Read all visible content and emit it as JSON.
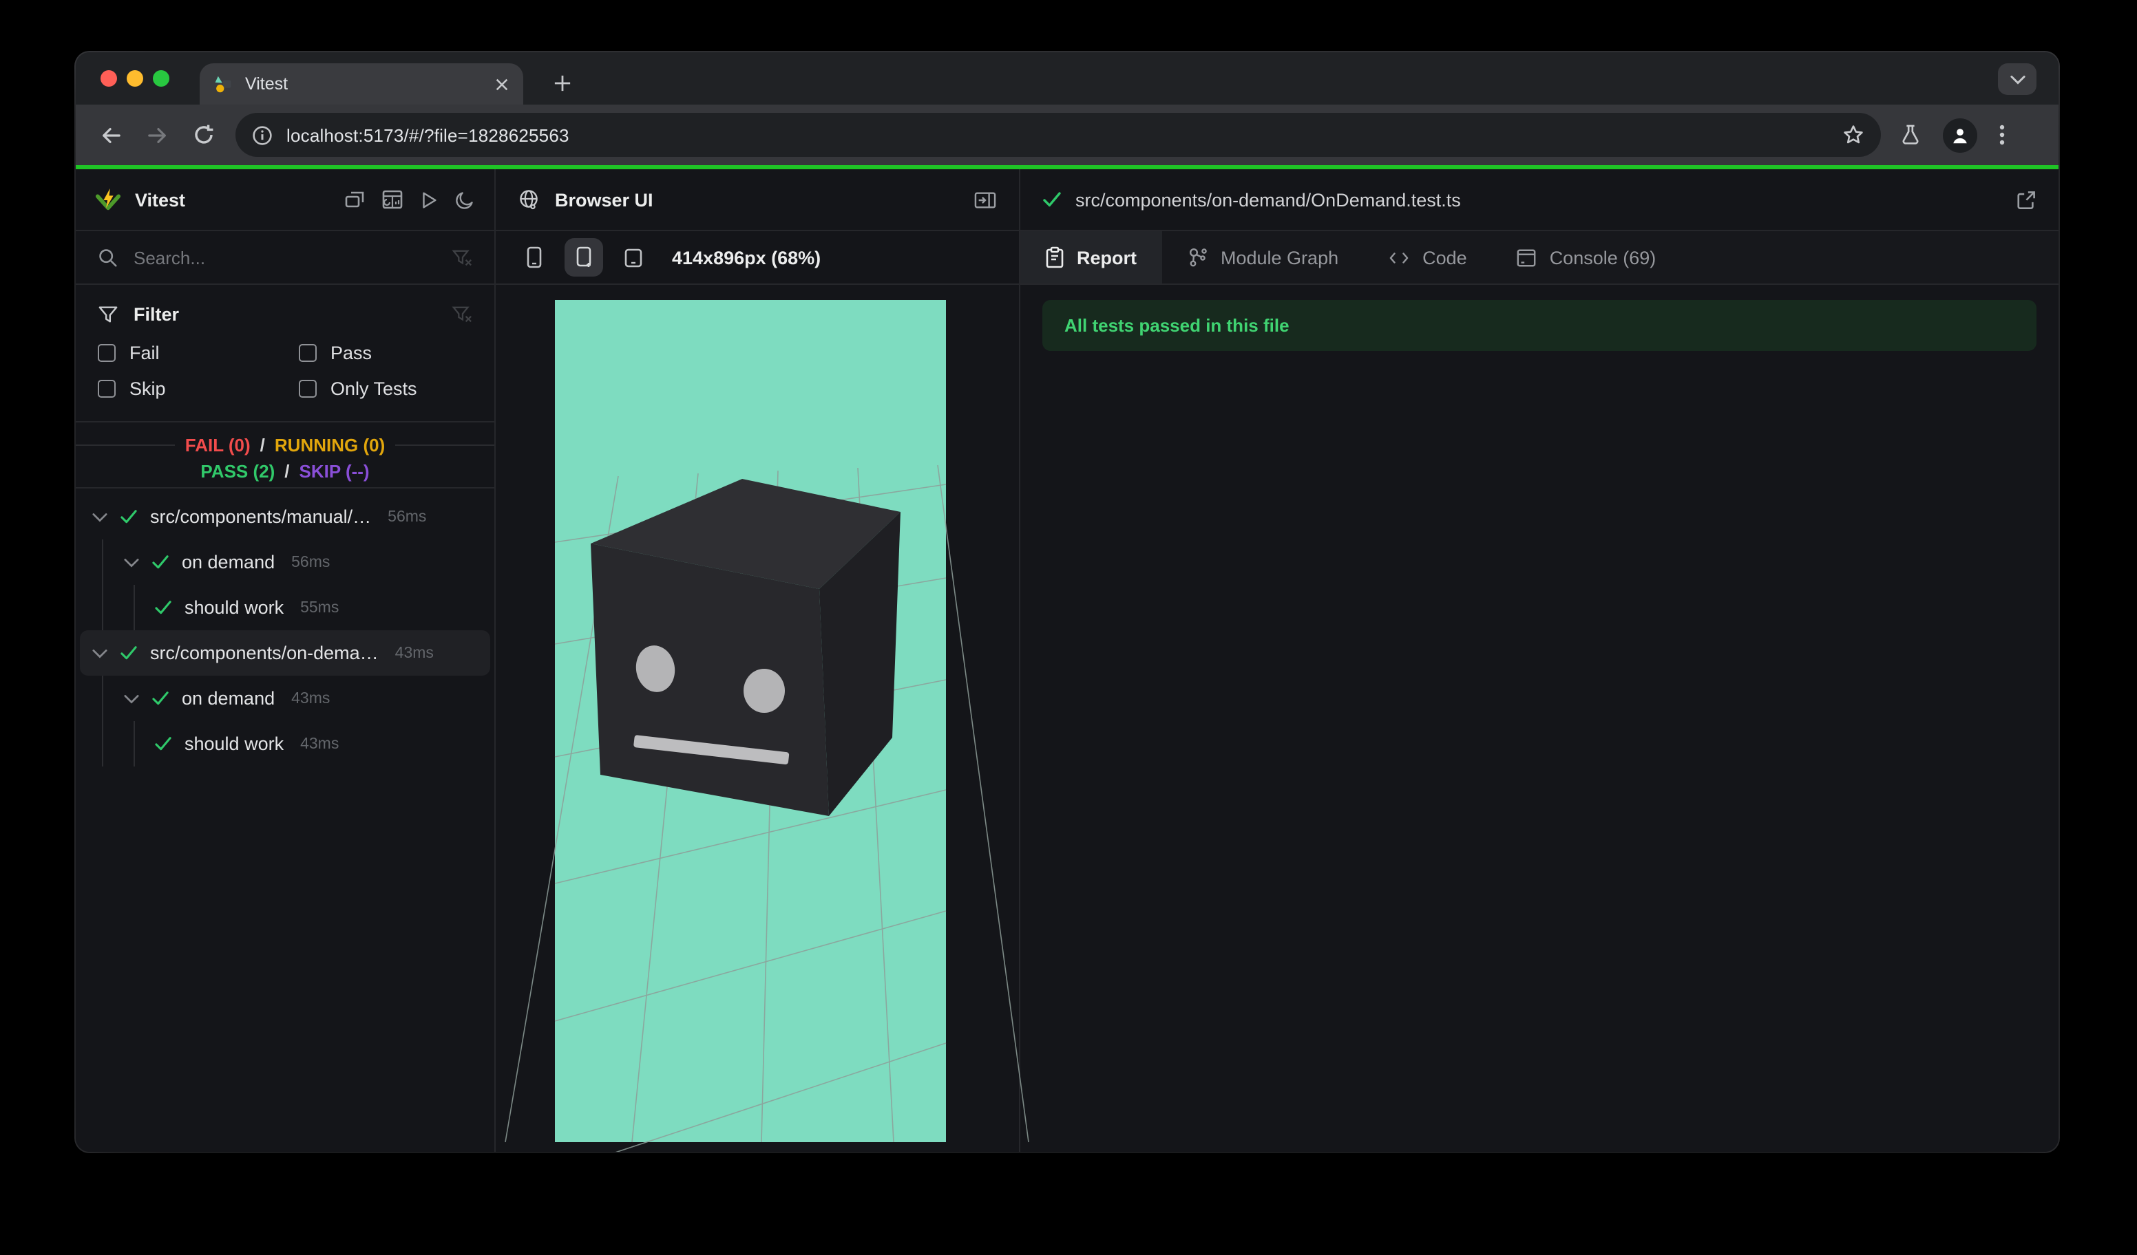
{
  "colors": {
    "progress": "#1fc426",
    "mint": "#7edcc0",
    "fail": "#f14c4c",
    "running": "#e2a60c",
    "pass": "#31c96a",
    "skip": "#8a4fd8",
    "check": "#2fc96a",
    "banner_bg": "#172a1e",
    "banner_text": "#40d472"
  },
  "chrome": {
    "tab_title": "Vitest",
    "url": "localhost:5173/#/?file=1828625563"
  },
  "sidebar": {
    "app_name": "Vitest",
    "search_placeholder": "Search...",
    "filter_title": "Filter",
    "filters": [
      {
        "label": "Fail",
        "checked": false
      },
      {
        "label": "Pass",
        "checked": false
      },
      {
        "label": "Skip",
        "checked": false
      },
      {
        "label": "Only Tests",
        "checked": false
      }
    ],
    "summary": {
      "fail": "FAIL (0)",
      "running": "RUNNING (0)",
      "pass": "PASS (2)",
      "skip": "SKIP (--)",
      "separator": "/"
    },
    "tree": [
      {
        "label": "src/components/manual/…",
        "duration": "56ms",
        "type": "file",
        "status": "pass"
      },
      {
        "label": "on demand",
        "duration": "56ms",
        "type": "suite",
        "status": "pass"
      },
      {
        "label": "should work",
        "duration": "55ms",
        "type": "test",
        "status": "pass"
      },
      {
        "label": "src/components/on-dema…",
        "duration": "43ms",
        "type": "file",
        "status": "pass",
        "selected": true
      },
      {
        "label": "on demand",
        "duration": "43ms",
        "type": "suite",
        "status": "pass"
      },
      {
        "label": "should work",
        "duration": "43ms",
        "type": "test",
        "status": "pass"
      }
    ]
  },
  "browser_panel": {
    "title": "Browser UI",
    "viewport_label": "414x896px (68%)"
  },
  "report_panel": {
    "file_path": "src/components/on-demand/OnDemand.test.ts",
    "tabs": [
      "Report",
      "Module Graph",
      "Code",
      "Console (69)"
    ],
    "active_tab": "Report",
    "banner_text": "All tests passed in this file"
  }
}
